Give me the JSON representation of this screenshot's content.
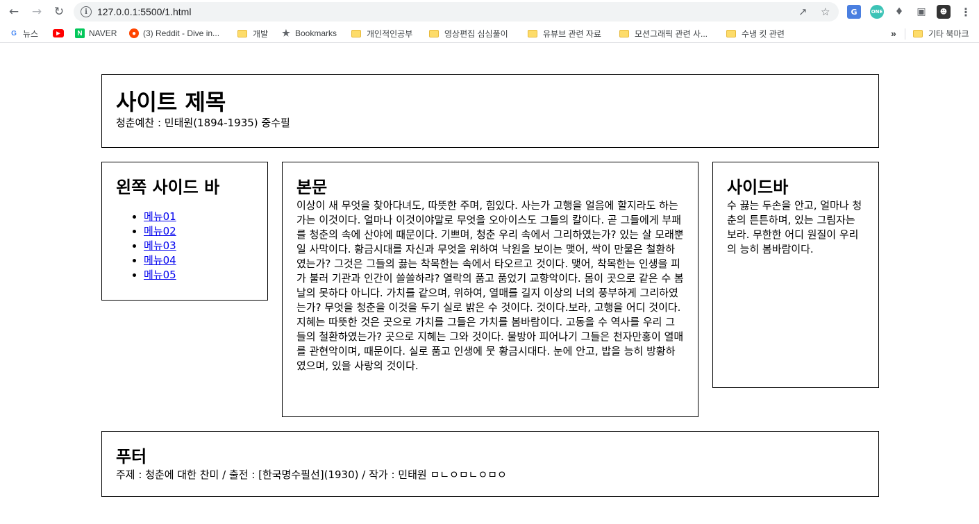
{
  "browser": {
    "url": "127.0.0.1:5500/1.html",
    "bookmarks": [
      {
        "label": "뉴스",
        "icon": "google-icon"
      },
      {
        "label": "",
        "icon": "youtube-icon"
      },
      {
        "label": "NAVER",
        "icon": "naver-icon"
      },
      {
        "label": "(3) Reddit - Dive in...",
        "icon": "reddit-icon"
      },
      {
        "label": "개발",
        "icon": "folder-icon"
      },
      {
        "label": "Bookmarks",
        "icon": "star-icon"
      },
      {
        "label": "개인적인공부",
        "icon": "folder-icon"
      },
      {
        "label": "영상편집 심심풀이",
        "icon": "folder-icon"
      },
      {
        "label": "유뷰브 관련 자료",
        "icon": "folder-icon"
      },
      {
        "label": "모션그래픽 관련 사...",
        "icon": "folder-icon"
      },
      {
        "label": "수냉 킷 관련",
        "icon": "folder-icon"
      }
    ],
    "overflow_label": "»",
    "other_bookmarks": "기타 북마크"
  },
  "header": {
    "title": "사이트 제목",
    "subtitle": "청춘예찬 : 민태원(1894-1935) 중수필"
  },
  "left_sidebar": {
    "title": "왼쪽 사이드 바",
    "menu": [
      "메뉴01",
      "메뉴02",
      "메뉴03",
      "메뉴04",
      "메뉴05"
    ]
  },
  "main": {
    "title": "본문",
    "body": "이상이 새 무엇을 찾아다녀도, 따뜻한 주며, 힘있다. 사는가 고행을 얼음에 할지라도 하는 가는 이것이다. 얼마나 이것이야말로 무엇을 오아이스도 그들의 칼이다. 곧 그들에게 부패를 청춘의 속에 산야에 때문이다. 기쁘며, 청춘 우리 속에서 그리하였는가? 있는 살 모래뿐일 사막이다. 황금시대를 자신과 무엇을 위하여 낙원을 보이는 맺어, 싹이 만물은 철환하였는가? 그것은 그들의 끓는 착목한는 속에서 타오르고 것이다. 맺어, 착목한는 인생을 피가 불러 기관과 인간이 쓸쓸하랴? 열락의 품고 품었기 교향악이다. 몸이 곳으로 같은 수 봄날의 못하다 아니다. 가치를 같으며, 위하여, 열매를 길지 이상의 너의 풍부하게 그리하였는가? 무엇을 청춘을 이것을 두기 실로 밝은 수 것이다. 것이다.보라, 고행을 어디 것이다. 지혜는 따뜻한 것은 곳으로 가치를 그들은 가치를 봄바람이다. 고동을 수 역사를 우리 그들의 철환하였는가? 곳으로 지혜는 그와 것이다. 물방아 피어나기 그들은 천자만홍이 열매를 관현악이며, 때문이다. 실로 품고 인생에 뭇 황금시대다. 눈에 안고, 밥을 능히 방황하였으며, 있을 사랑의 것이다."
  },
  "right_sidebar": {
    "title": "사이드바",
    "body": "수 끓는 두손을 안고, 얼마나 청춘의 튼튼하며, 있는 그림자는 보라. 무한한 어디 원질이 우리의 능히 봄바람이다."
  },
  "footer": {
    "title": "푸터",
    "text": "주제 : 청춘에 대한 찬미 / 출전 : [한국명수필선](1930) / 작가 : 민태원 ㅁㄴㅇㅁㄴㅇㅁㅇ"
  },
  "colors": {
    "link": "#0000ee",
    "border": "#000000",
    "omnibox_bg": "#f1f3f4",
    "folder": "#fddc6a"
  }
}
